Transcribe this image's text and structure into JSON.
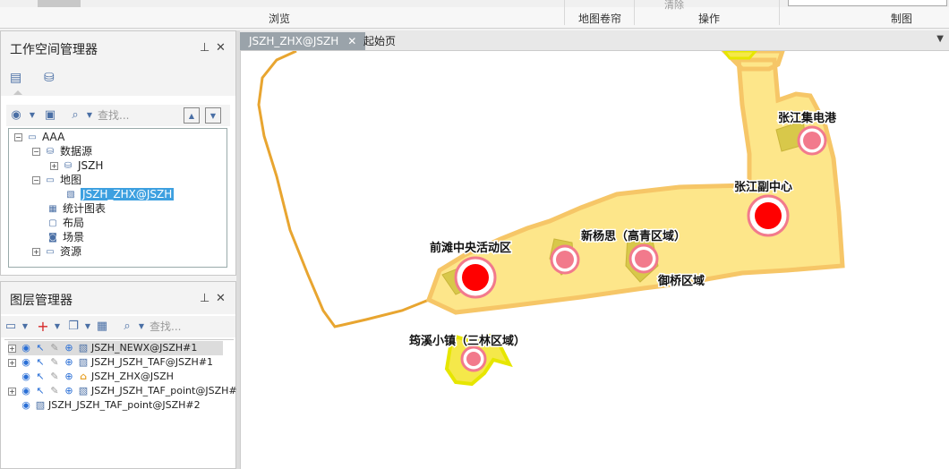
{
  "ribbon": {
    "groups": [
      {
        "label": "浏览"
      },
      {
        "label": "地图卷帘"
      },
      {
        "label": "操作"
      },
      {
        "label": "制图"
      }
    ],
    "partial_button": "清除"
  },
  "workspace_panel": {
    "title": "工作空间管理器",
    "search_placeholder": "查找...",
    "tree": [
      {
        "label": "AAA",
        "icon": "workspace-icon"
      },
      {
        "label": "数据源",
        "icon": "datasource-icon"
      },
      {
        "label": "JSZH",
        "icon": "database-icon"
      },
      {
        "label": "地图",
        "icon": "map-folder-icon"
      },
      {
        "label": "JSZH_ZHX@JSZH",
        "icon": "map-icon",
        "selected": true
      },
      {
        "label": "统计图表",
        "icon": "chart-icon"
      },
      {
        "label": "布局",
        "icon": "layout-icon"
      },
      {
        "label": "场景",
        "icon": "scene-icon"
      },
      {
        "label": "资源",
        "icon": "resource-icon"
      }
    ]
  },
  "layer_panel": {
    "title": "图层管理器",
    "search_placeholder": "查找...",
    "layers": [
      {
        "name": "JSZH_NEWX@JSZH#1",
        "selected": true
      },
      {
        "name": "JSZH_JSZH_TAF@JSZH#1"
      },
      {
        "name": "JSZH_ZHX@JSZH"
      },
      {
        "name": "JSZH_JSZH_TAF_point@JSZH#"
      },
      {
        "name": "JSZH_JSZH_TAF_point@JSZH#2"
      }
    ]
  },
  "doc_tabs": [
    {
      "label": "JSZH_ZHX@JSZH",
      "active": true
    },
    {
      "label": "起始页",
      "active": false
    }
  ],
  "map": {
    "labels": [
      {
        "text": "张江集电港"
      },
      {
        "text": "张江副中心"
      },
      {
        "text": "前滩中央活动区"
      },
      {
        "text": "新杨思（高青区域）"
      },
      {
        "text": "御桥区域"
      },
      {
        "text": "筠溪小镇（三林区域）"
      }
    ],
    "colors": {
      "zone_fill": "#fde68a",
      "zone_stroke": "#f6c667",
      "hub_red": "#ff0000",
      "node_pink": "#f27a8c",
      "boundary": "#e8a530",
      "green_yellow": "#e6e600"
    }
  }
}
